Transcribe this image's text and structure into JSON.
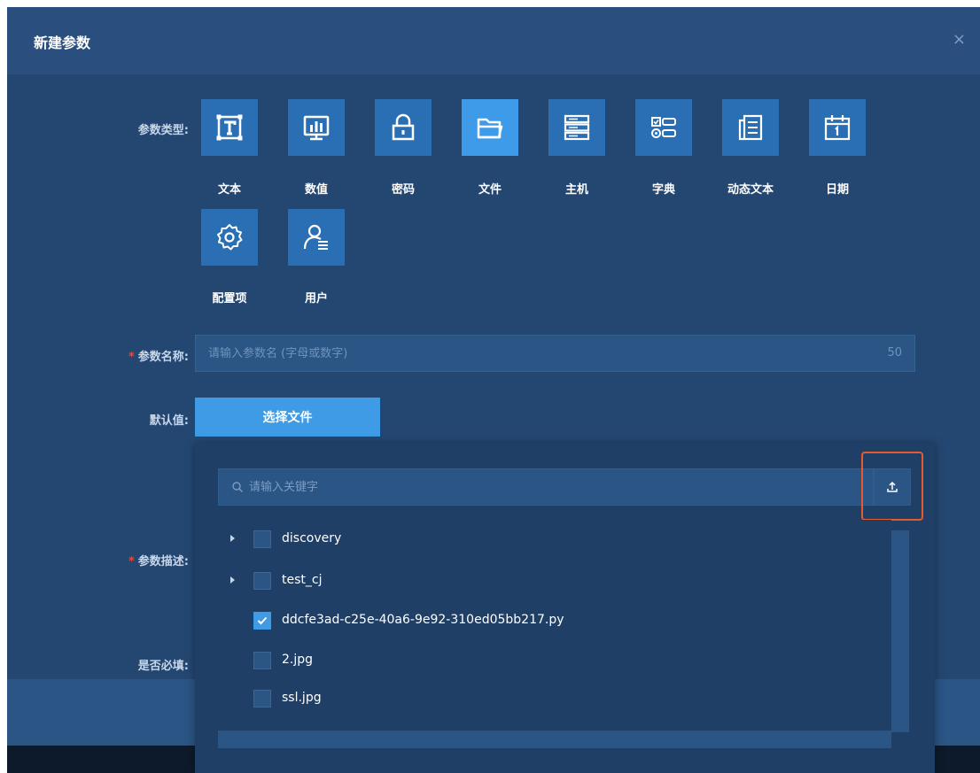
{
  "dialog": {
    "title": "新建参数",
    "close": "×"
  },
  "form": {
    "param_type_label": "参数类型:",
    "param_name_label": "参数名称:",
    "default_value_label": "默认值:",
    "param_desc_label": "参数描述:",
    "required_label": "是否必填:",
    "required_mark": "*"
  },
  "types": [
    {
      "label": "文本",
      "icon": "text-icon",
      "selected": false
    },
    {
      "label": "数值",
      "icon": "chart-icon",
      "selected": false
    },
    {
      "label": "密码",
      "icon": "lock-icon",
      "selected": false
    },
    {
      "label": "文件",
      "icon": "folder-icon",
      "selected": true
    },
    {
      "label": "主机",
      "icon": "server-icon",
      "selected": false
    },
    {
      "label": "字典",
      "icon": "dictionary-icon",
      "selected": false
    },
    {
      "label": "动态文本",
      "icon": "document-icon",
      "selected": false
    },
    {
      "label": "日期",
      "icon": "calendar-icon",
      "selected": false
    },
    {
      "label": "配置项",
      "icon": "gear-icon",
      "selected": false
    },
    {
      "label": "用户",
      "icon": "user-icon",
      "selected": false
    }
  ],
  "name_input": {
    "placeholder": "请输入参数名 (字母或数字)",
    "count": "50"
  },
  "choose_file_button": "选择文件",
  "file_picker": {
    "search_placeholder": "请输入关键字",
    "items": [
      {
        "name": "discovery",
        "folder": true,
        "checked": false
      },
      {
        "name": "test_cj",
        "folder": true,
        "checked": false
      },
      {
        "name": "ddcfe3ad-c25e-40a6-9e92-310ed05bb217.py",
        "folder": false,
        "checked": true
      },
      {
        "name": "2.jpg",
        "folder": false,
        "checked": false
      },
      {
        "name": "ssl.jpg",
        "folder": false,
        "checked": false
      }
    ]
  },
  "colors": {
    "dialog_bg": "#244772",
    "tile": "#2a6fb4",
    "tile_selected": "#3d9be9",
    "accent": "#3f9be6",
    "required": "#e8493b",
    "highlight": "#e65a2f"
  }
}
